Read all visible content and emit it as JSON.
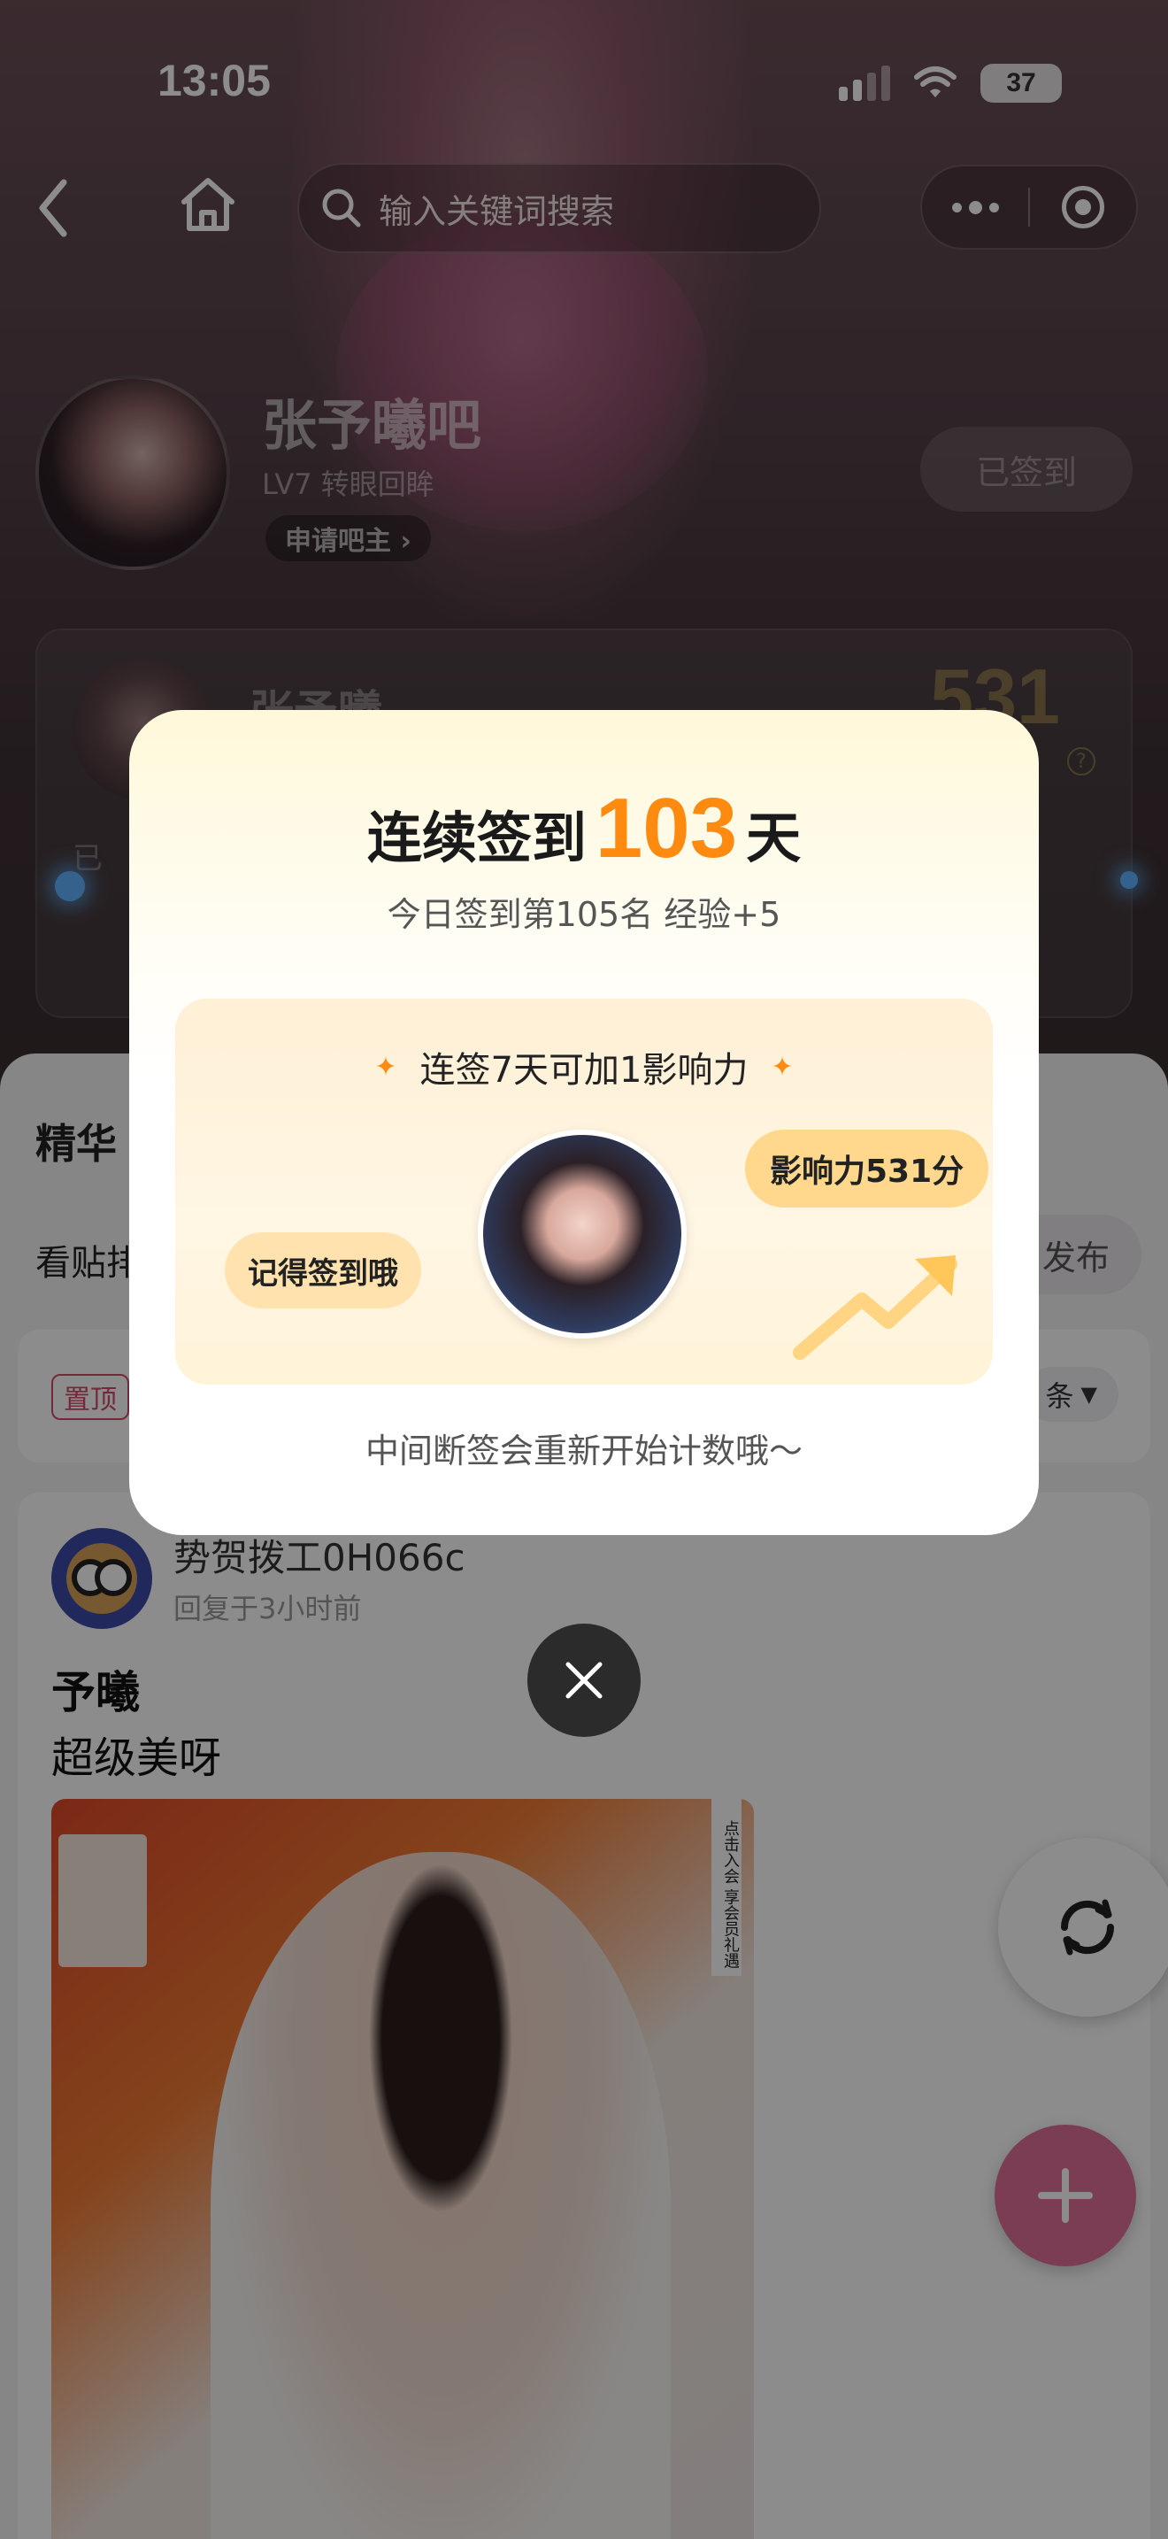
{
  "status_bar": {
    "time": "13:05",
    "battery": "37"
  },
  "nav": {
    "search_placeholder": "输入关键词搜索"
  },
  "forum": {
    "name": "张予曦吧",
    "level": "LV7 转眼回眸",
    "apply_owner": "申请吧主 ›",
    "signed_label": "已签到"
  },
  "member_card": {
    "name": "张予曦",
    "score": "531",
    "sub": "已"
  },
  "content": {
    "tab_essence": "精华",
    "sub_row_label": "看贴排",
    "publish_label": "发布",
    "pin_tag": "置顶",
    "sort_label": "条"
  },
  "post": {
    "author": "势贺拨工0H066c",
    "time": "回复于3小时前",
    "title": "予曦",
    "body": "超级美呀",
    "image_side_banner": "点击入会 享会员礼遇"
  },
  "checkin_modal": {
    "title_prefix": "连续签到",
    "days": "103",
    "title_suffix": "天",
    "subtitle": "今日签到第105名 经验+5",
    "reward_head": "连签7天可加1影响力",
    "bubble_influence": "影响力531分",
    "bubble_remind": "记得签到哦",
    "footer": "中间断签会重新开始计数哦～"
  },
  "colors": {
    "accent_orange": "#ff8a10",
    "fab_pink": "#e0709a",
    "pin_red": "#d9486a"
  },
  "icons": {
    "back": "chevron-left-icon",
    "home": "home-icon",
    "search": "search-icon",
    "more": "more-dots-icon",
    "target": "target-icon",
    "refresh": "refresh-icon",
    "add": "plus-icon",
    "close": "close-icon"
  }
}
